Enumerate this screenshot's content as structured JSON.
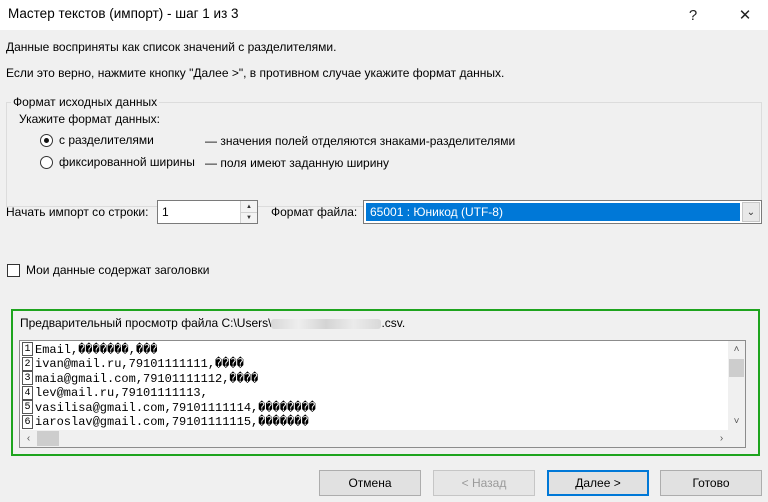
{
  "window": {
    "title": "Мастер текстов (импорт) - шаг 1 из 3",
    "help_glyph": "?",
    "close_glyph": "✕"
  },
  "intro": {
    "line1": "Данные восприняты как список значений с разделителями.",
    "line2": "Если это верно, нажмите кнопку \"Далее >\", в противном случае укажите формат данных."
  },
  "format_group": {
    "legend": "Формат исходных данных",
    "prompt": "Укажите формат данных:",
    "options": [
      {
        "label": "с разделителями",
        "description": "— значения полей отделяются знаками-разделителями",
        "checked": true
      },
      {
        "label": "фиксированной ширины",
        "description": "— поля имеют заданную ширину",
        "checked": false
      }
    ]
  },
  "start_row": {
    "label": "Начать импорт со строки:",
    "value": "1"
  },
  "file_format": {
    "label": "Формат файла:",
    "value": "65001 : Юникод (UTF-8)"
  },
  "headers_checkbox": {
    "label": "Мои данные содержат заголовки",
    "checked": false
  },
  "preview": {
    "title_prefix": "Предварительный просмотр файла C:\\Users\\",
    "title_suffix": ".csv.",
    "rows": [
      {
        "num": "1",
        "text": "Email,�������,���"
      },
      {
        "num": "2",
        "text": "ivan@mail.ru,79101111111,����"
      },
      {
        "num": "3",
        "text": "maia@gmail.com,79101111112,����"
      },
      {
        "num": "4",
        "text": "lev@mail.ru,79101111113,"
      },
      {
        "num": "5",
        "text": "vasilisa@gmail.com,79101111114,��������"
      },
      {
        "num": "6",
        "text": "iaroslav@gmail.com,79101111115,�������"
      }
    ]
  },
  "buttons": {
    "cancel": "Отмена",
    "back": "< Назад",
    "next": "Далее >",
    "finish": "Готово"
  },
  "colors": {
    "accent": "#0078d7",
    "highlight_border": "#1ea41e"
  }
}
